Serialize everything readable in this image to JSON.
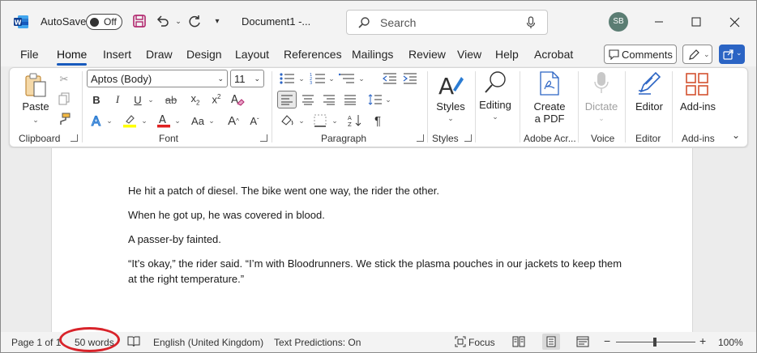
{
  "titlebar": {
    "autosave_label": "AutoSave",
    "autosave_state": "Off",
    "document_title": "Document1  -...",
    "search_placeholder": "Search",
    "user_initials": "SB"
  },
  "tabs": [
    "File",
    "Home",
    "Insert",
    "Draw",
    "Design",
    "Layout",
    "References",
    "Mailings",
    "Review",
    "View",
    "Help",
    "Acrobat"
  ],
  "active_tab": "Home",
  "actions": {
    "comments_label": "Comments"
  },
  "ribbon": {
    "clipboard": {
      "paste_label": "Paste",
      "group_label": "Clipboard"
    },
    "font": {
      "font_name": "Aptos (Body)",
      "font_size": "11",
      "group_label": "Font",
      "change_case_label": "Aa"
    },
    "paragraph": {
      "group_label": "Paragraph"
    },
    "styles": {
      "styles_label": "Styles",
      "group_label": "Styles"
    },
    "editing": {
      "editing_label": "Editing"
    },
    "adobe": {
      "create_pdf_label_1": "Create",
      "create_pdf_label_2": "a PDF",
      "group_label": "Adobe Acr..."
    },
    "voice": {
      "dictate_label": "Dictate",
      "group_label": "Voice"
    },
    "editor": {
      "editor_label": "Editor",
      "group_label": "Editor"
    },
    "addins": {
      "addins_label": "Add-ins",
      "group_label": "Add-ins"
    }
  },
  "document": {
    "paragraphs": [
      "He hit a patch of diesel. The bike went one way, the rider the other.",
      "When he got up, he was covered in blood.",
      "A passer-by fainted.",
      "“It’s okay,” the rider said. “I’m with Bloodrunners. We stick the plasma pouches in our jackets to keep them at the right temperature.”"
    ]
  },
  "statusbar": {
    "page": "Page 1 of 1",
    "words": "50 words",
    "language": "English (United Kingdom)",
    "text_predictions": "Text Predictions: On",
    "focus": "Focus",
    "zoom_minus": "−",
    "zoom_plus": "+",
    "zoom": "100%"
  },
  "annotation_color": "#d8232a",
  "brand_color": "#185abd"
}
